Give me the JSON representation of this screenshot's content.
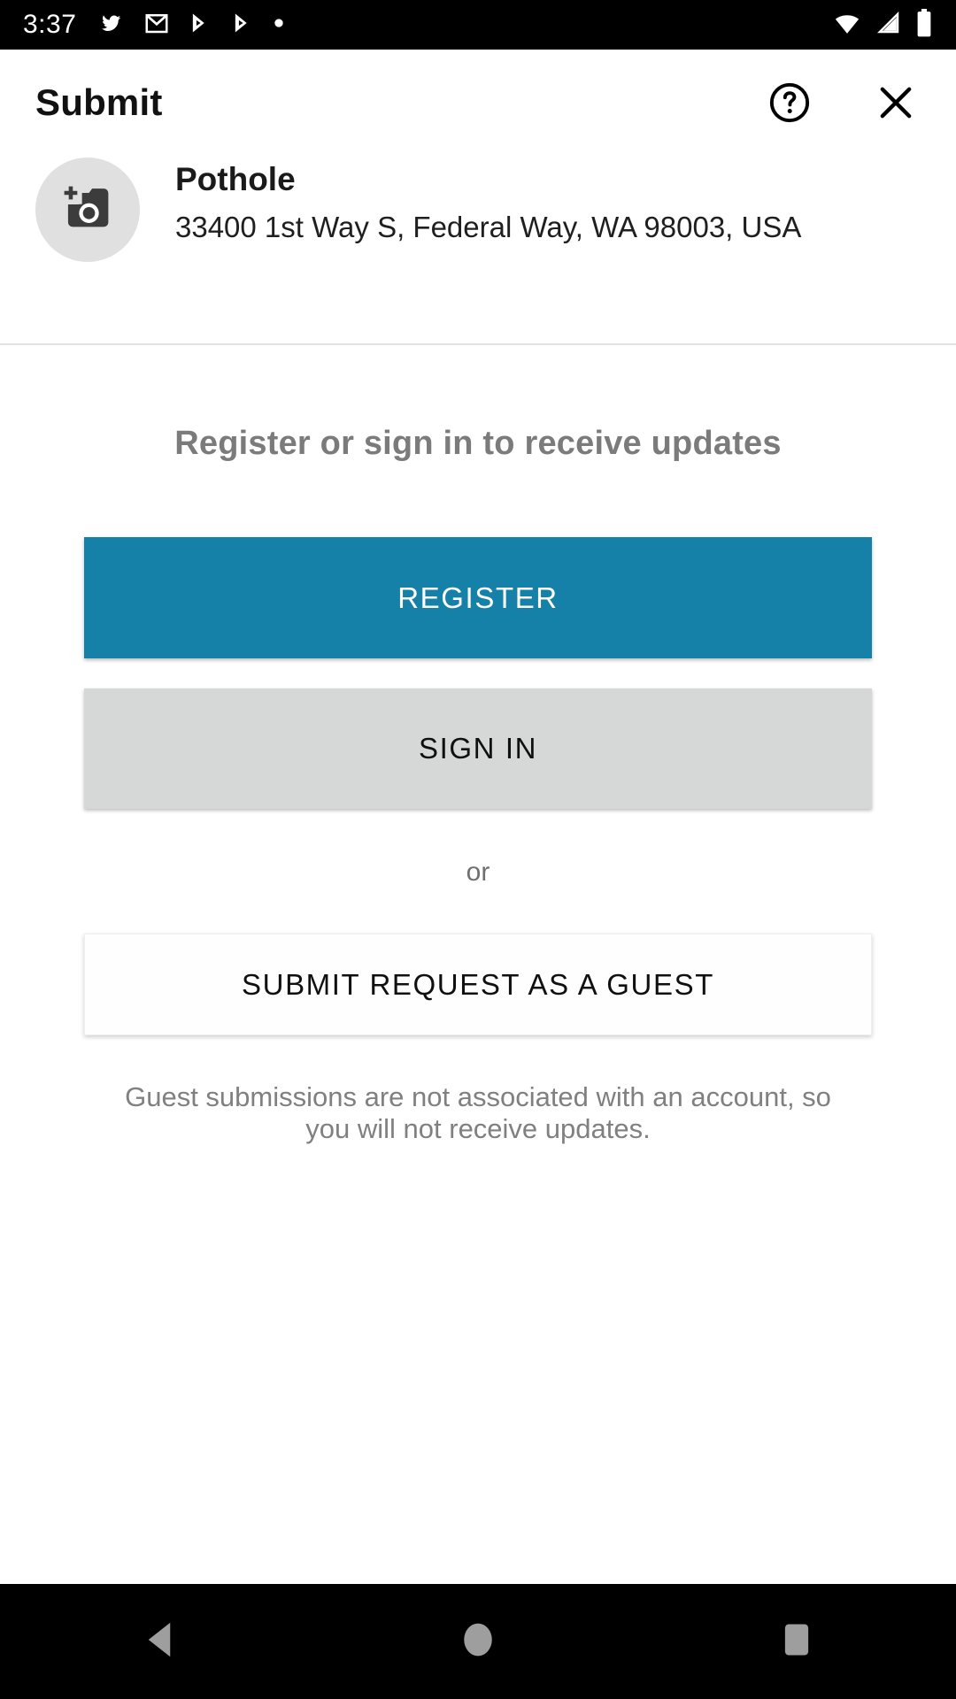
{
  "status_bar": {
    "clock": "3:37",
    "left_icons": [
      "twitter-icon",
      "gmail-icon",
      "play-store-icon",
      "play-store-icon",
      "dot-icon"
    ],
    "right_icons": [
      "wifi-icon",
      "cell-signal-icon",
      "battery-icon"
    ],
    "background": "#000000",
    "foreground": "#ffffff"
  },
  "appbar": {
    "title": "Submit",
    "help_icon": "help-circle-icon",
    "close_icon": "close-icon"
  },
  "summary": {
    "thumbnail_icon": "add-photo-camera-icon",
    "title": "Pothole",
    "address": "33400 1st Way S, Federal Way, WA 98003, USA"
  },
  "body": {
    "prompt": "Register or sign in to receive updates",
    "register_label": "REGISTER",
    "signin_label": "SIGN IN",
    "or_label": "or",
    "guest_label": "SUBMIT REQUEST AS A GUEST",
    "disclaimer": "Guest submissions are not associated with an account, so you will not receive updates."
  },
  "colors": {
    "primary": "#1580a8",
    "secondary": "#d6d7d7",
    "muted_text": "#7b7b7b",
    "divider": "#e2e2e2",
    "nav_icon": "#9e9e9e"
  },
  "navbar": {
    "back_icon": "back-triangle-icon",
    "home_icon": "home-circle-icon",
    "recents_icon": "recents-square-icon"
  }
}
